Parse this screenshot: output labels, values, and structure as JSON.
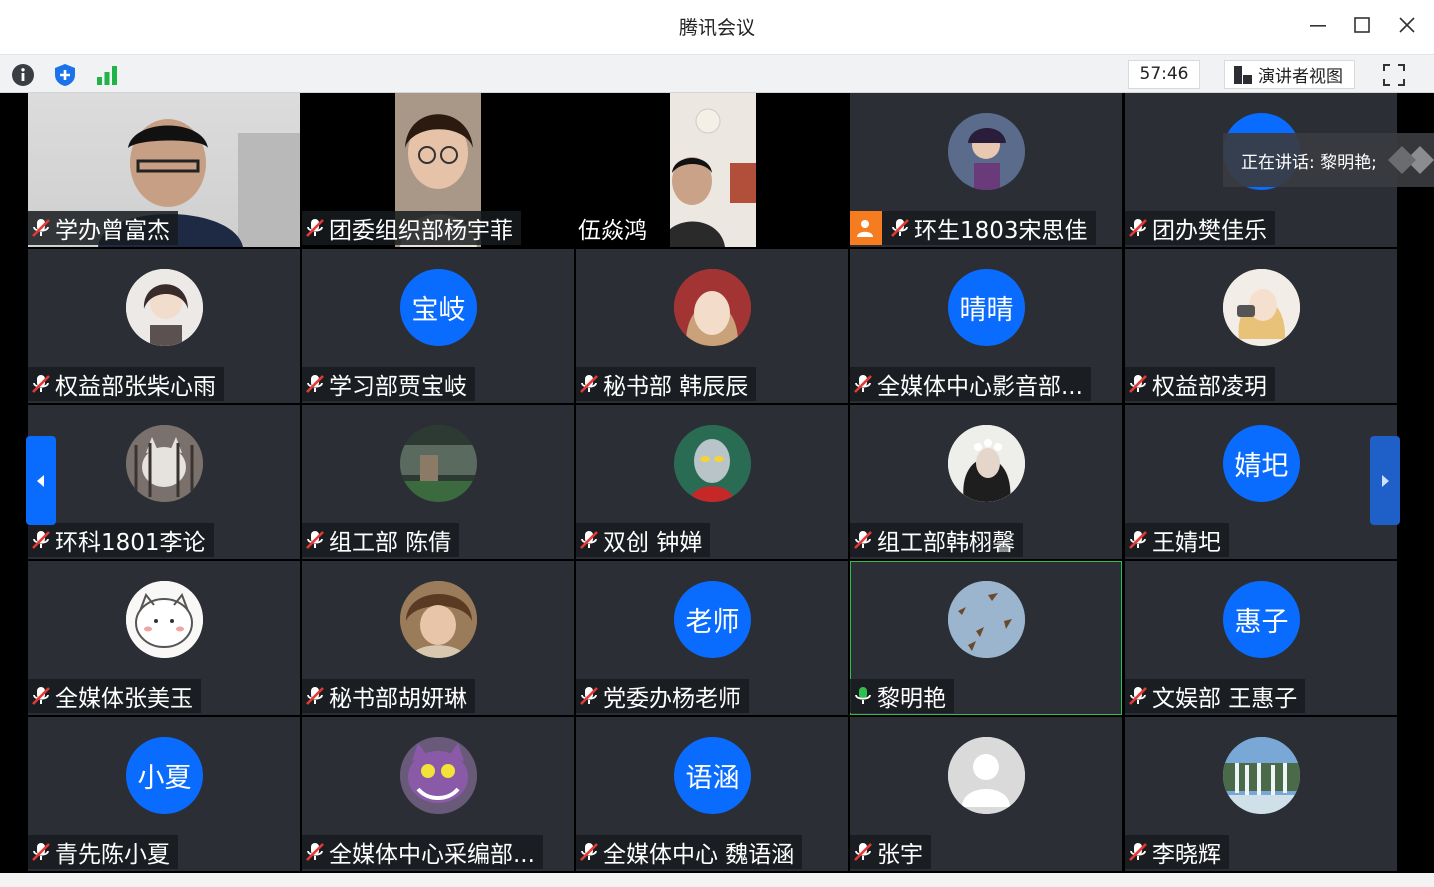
{
  "window": {
    "title": "腾讯会议"
  },
  "toolbar": {
    "info_icon": "info-icon",
    "security_icon": "shield-icon",
    "signal_icon": "signal-icon",
    "duration": "57:46",
    "view_label": "演讲者视图",
    "fullscreen_icon": "fullscreen-icon"
  },
  "speaking": {
    "text": "正在讲话: 黎明艳;"
  },
  "colors": {
    "accent": "#0a6cff",
    "host_badge": "#f57c1f",
    "active_border": "#2fbf4f",
    "tile_bg": "#2b2f35"
  },
  "participants": [
    {
      "name": "学办曾富杰",
      "type": "video",
      "mic": "muted"
    },
    {
      "name": "团委组织部杨宇菲",
      "type": "video",
      "mic": "muted"
    },
    {
      "name": "伍焱鸿",
      "type": "video",
      "mic": "none"
    },
    {
      "name": "环生1803宋思佳",
      "type": "photo",
      "mic": "muted",
      "host": true
    },
    {
      "name": "团办樊佳乐",
      "type": "initials",
      "initials": "",
      "mic": "muted"
    },
    {
      "name": "权益部张柴心雨",
      "type": "photo",
      "mic": "muted"
    },
    {
      "name": "学习部贾宝岐",
      "type": "initials",
      "initials": "宝岐",
      "mic": "muted"
    },
    {
      "name": "秘书部 韩辰辰",
      "type": "photo",
      "mic": "muted"
    },
    {
      "name": "全媒体中心影音部...",
      "type": "initials",
      "initials": "晴晴",
      "mic": "muted"
    },
    {
      "name": "权益部凌玥",
      "type": "photo",
      "mic": "muted"
    },
    {
      "name": "环科1801李论",
      "type": "photo",
      "mic": "muted"
    },
    {
      "name": "组工部 陈倩",
      "type": "photo",
      "mic": "muted"
    },
    {
      "name": "双创 钟婵",
      "type": "photo",
      "mic": "muted"
    },
    {
      "name": "组工部韩栩馨",
      "type": "photo",
      "mic": "muted"
    },
    {
      "name": "王婧圯",
      "type": "initials",
      "initials": "婧圯",
      "mic": "muted"
    },
    {
      "name": "全媒体张美玉",
      "type": "photo",
      "mic": "muted"
    },
    {
      "name": "秘书部胡妍琳",
      "type": "photo",
      "mic": "muted"
    },
    {
      "name": "党委办杨老师",
      "type": "initials",
      "initials": "老师",
      "mic": "muted"
    },
    {
      "name": "黎明艳",
      "type": "photo",
      "mic": "on",
      "active": true
    },
    {
      "name": "文娱部 王惠子",
      "type": "initials",
      "initials": "惠子",
      "mic": "muted"
    },
    {
      "name": "青先陈小夏",
      "type": "initials",
      "initials": "小夏",
      "mic": "muted"
    },
    {
      "name": "全媒体中心采编部...",
      "type": "photo",
      "mic": "muted"
    },
    {
      "name": "全媒体中心 魏语涵",
      "type": "initials",
      "initials": "语涵",
      "mic": "muted"
    },
    {
      "name": "张宇",
      "type": "default",
      "mic": "muted"
    },
    {
      "name": "李晓辉",
      "type": "photo",
      "mic": "muted"
    }
  ]
}
